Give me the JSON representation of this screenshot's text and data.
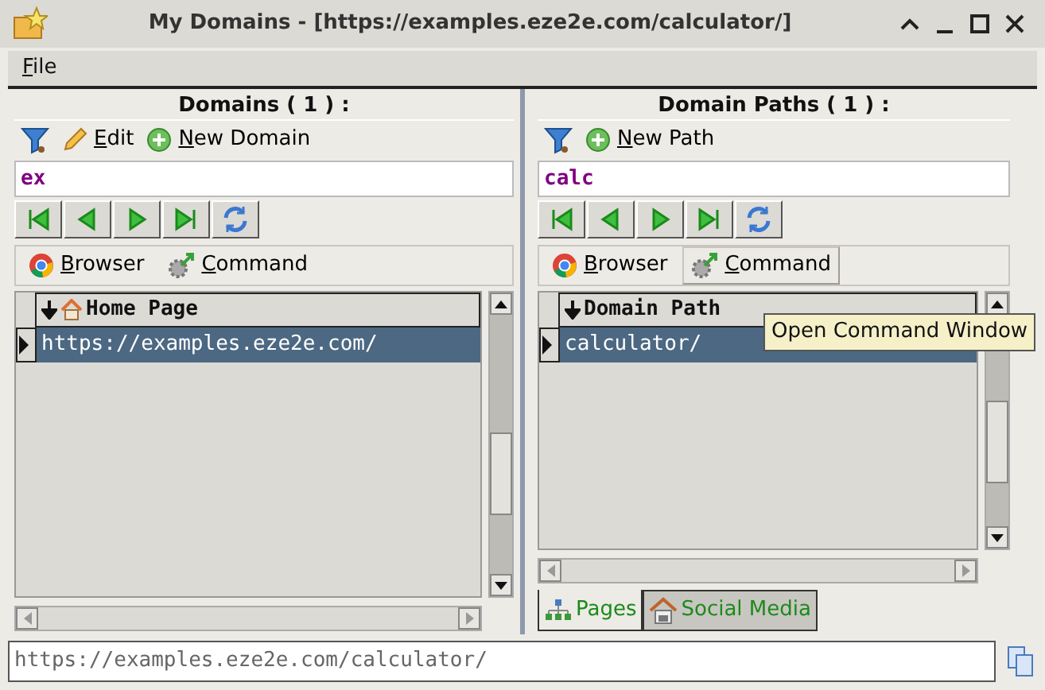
{
  "window": {
    "title": "My Domains - [https://examples.eze2e.com/calculator/]"
  },
  "menu": [
    {
      "label": "File"
    }
  ],
  "panels": [
    {
      "title": "Domains ( 1 ) :",
      "toolbar": [
        {
          "kind": "filter"
        },
        {
          "kind": "edit",
          "label": "Edit"
        },
        {
          "kind": "add",
          "label": "New Domain"
        }
      ],
      "filter": {
        "value": "ex"
      },
      "launch_buttons": [
        {
          "kind": "browser",
          "label": "Browser",
          "hovered": false
        },
        {
          "kind": "command",
          "label": "Command",
          "hovered": false
        }
      ],
      "table": {
        "column": {
          "kind": "home",
          "label": "Home Page"
        },
        "rows": [
          {
            "cell": "https://examples.eze2e.com/",
            "selected": true
          }
        ]
      }
    },
    {
      "title": "Domain Paths ( 1 ) :",
      "toolbar": [
        {
          "kind": "filter"
        },
        {
          "kind": "add",
          "label": "New Path"
        }
      ],
      "filter": {
        "value": "calc"
      },
      "launch_buttons": [
        {
          "kind": "browser",
          "label": "Browser",
          "hovered": false
        },
        {
          "kind": "command",
          "label": "Command",
          "hovered": true
        }
      ],
      "table": {
        "column": {
          "kind": "plain",
          "label": "Domain Path"
        },
        "rows": [
          {
            "cell": "calculator/",
            "selected": true
          }
        ]
      },
      "tooltip": "Open Command Window",
      "bottom_tabs": [
        {
          "kind": "pages",
          "label": "Pages",
          "selected": true
        },
        {
          "kind": "social",
          "label": "Social Media",
          "selected": false
        }
      ]
    }
  ],
  "status_field": {
    "value": "https://examples.eze2e.com/calculator/"
  }
}
